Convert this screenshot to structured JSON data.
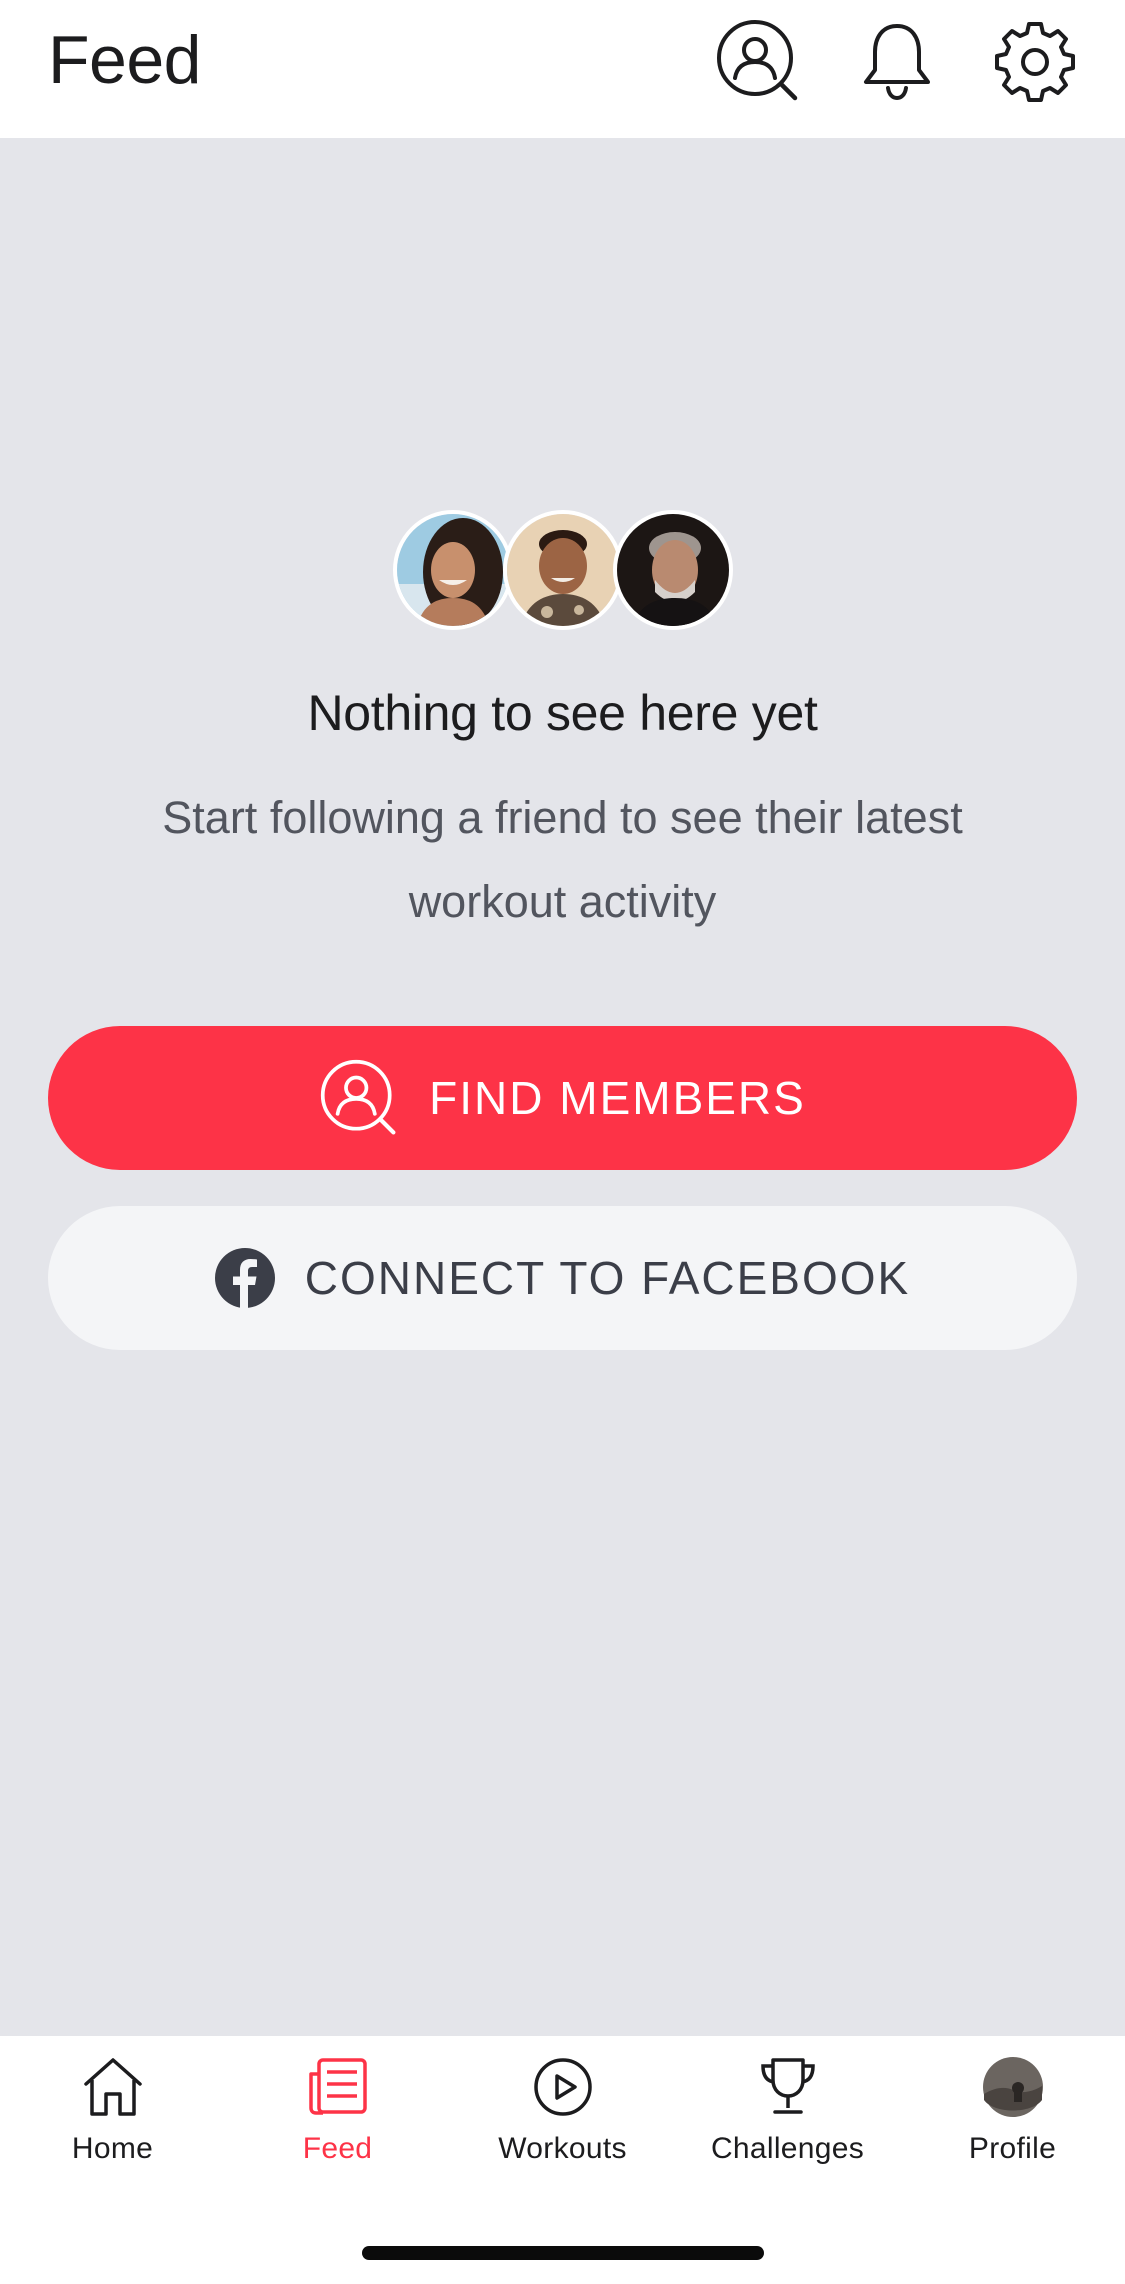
{
  "header": {
    "title": "Feed",
    "icons": [
      "find-member-icon",
      "bell-icon",
      "gear-icon"
    ]
  },
  "empty_state": {
    "title": "Nothing to see here yet",
    "subtitle": "Start following a friend to see their latest workout activity"
  },
  "buttons": {
    "find_members": "FIND MEMBERS",
    "connect_facebook": "CONNECT TO FACEBOOK"
  },
  "tabs": [
    {
      "label": "Home",
      "icon": "home-icon",
      "active": false
    },
    {
      "label": "Feed",
      "icon": "feed-icon",
      "active": true
    },
    {
      "label": "Workouts",
      "icon": "play-circle-icon",
      "active": false
    },
    {
      "label": "Challenges",
      "icon": "trophy-icon",
      "active": false
    },
    {
      "label": "Profile",
      "icon": "profile-avatar",
      "active": false
    }
  ],
  "colors": {
    "accent": "#fd3347",
    "background": "#e4e5ea",
    "facebook_button": "#f4f5f7",
    "text_primary": "#1c1c1e",
    "text_secondary": "#52555e"
  }
}
